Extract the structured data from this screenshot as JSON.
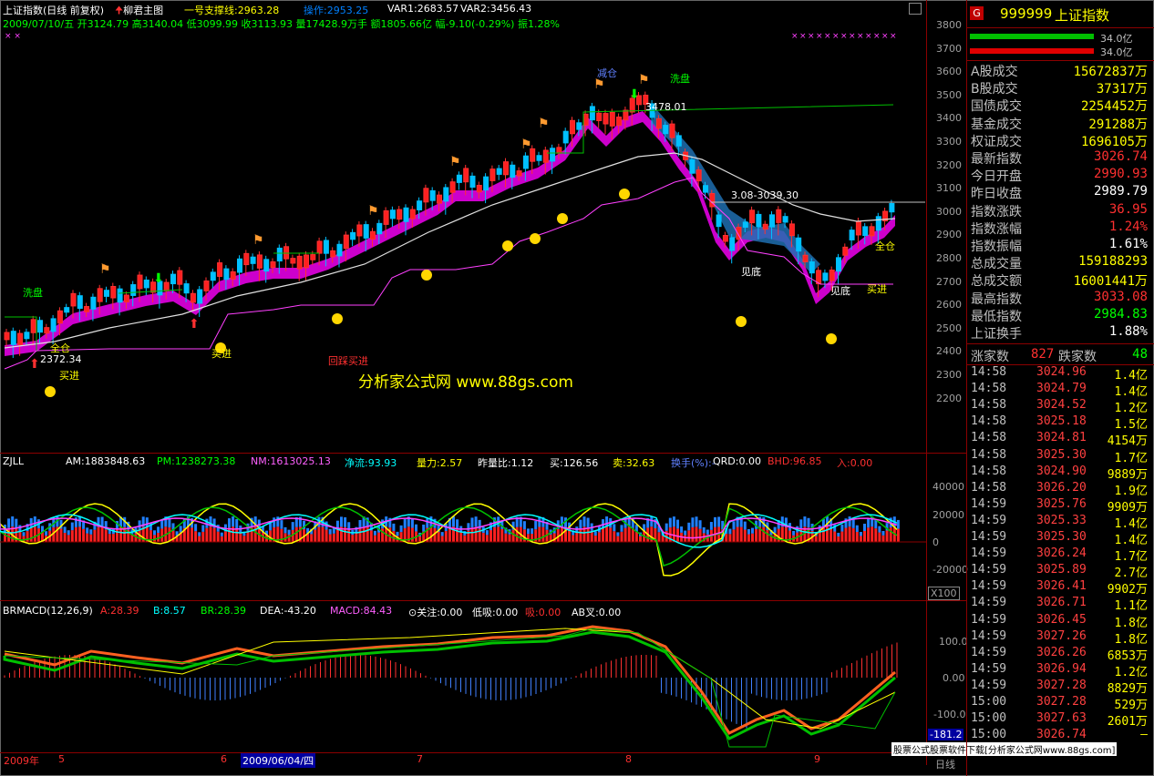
{
  "header": {
    "title": "上证指数(日线 前复权)",
    "indicator": "柳君主图",
    "support": "一号支撑线:2963.28",
    "op": "操作:2953.25",
    "var1": "VAR1:2683.57",
    "var2": "VAR2:3456.43",
    "ohlc": "2009/07/10/五 开3124.79 高3140.04 低3099.99 收3113.93 量17428.9万手 额1805.66亿 幅-9.10(-0.29%) 振1.28%"
  },
  "main_annotations": {
    "xipan1": "洗盘",
    "xipan2": "洗盘",
    "jiancang": "减仓",
    "quancang1": "全仓",
    "quancang2": "全仓",
    "maijin1": "买进",
    "maijin2": "买进",
    "maijin3": "买进",
    "huicai": "回踩买进",
    "jiandi1": "见底",
    "jiandi2": "见底",
    "low_price": "2372.34",
    "high_price": "3478.01",
    "range_text": "3.08-3039.30",
    "watermark": "分析家公式网 www.88gs.com"
  },
  "main_axis": [
    "3800",
    "3700",
    "3600",
    "3500",
    "3400",
    "3300",
    "3200",
    "3100",
    "3000",
    "2900",
    "2800",
    "2700",
    "2600",
    "2500",
    "2400",
    "2300",
    "2200"
  ],
  "zjll": {
    "name": "ZJLL",
    "am": "AM:1883848.63",
    "pm": "PM:1238273.38",
    "nm": "NM:1613025.13",
    "jl": "净流:93.93",
    "ll": "量力:2.57",
    "zlb": "昨量比:1.12",
    "buy": "买:126.56",
    "sell": "卖:32.63",
    "hs": "换手(%):-",
    "qrd": "QRD:0.00",
    "bhd": "BHD:96.85",
    "ru": "入:0.00",
    "axis": [
      "40000",
      "20000",
      "0",
      "-20000"
    ],
    "scale": "X100"
  },
  "brmacd": {
    "name": "BRMACD(12,26,9)",
    "a": "A:28.39",
    "b": "B:8.57",
    "br": "BR:28.39",
    "dea": "DEA:-43.20",
    "macd": "MACD:84.43",
    "gz": "关注:0.00",
    "dx": "低吸:0.00",
    "xi": "吸:0.00",
    "ab": "AB叉:0.00",
    "axis": [
      "100.0",
      "0.00",
      "-100.0"
    ],
    "cur": "-181.2"
  },
  "date_axis": {
    "year": "2009年",
    "m5": "5",
    "m6": "6",
    "cursor": "2009/06/04/四",
    "m7": "7",
    "m8": "8",
    "m9": "9",
    "period": "日线"
  },
  "footer": "股票公式股票软件下载[分析家公式网www.88gs.com]",
  "quote": {
    "badge": "G",
    "code": "999999",
    "name": "上证指数",
    "bar1": "34.0亿",
    "bar2": "34.0亿",
    "rows": [
      {
        "label": "A股成交",
        "value": "15672837万",
        "color": "#ffff00"
      },
      {
        "label": "B股成交",
        "value": "37317万",
        "color": "#ffff00"
      },
      {
        "label": "国债成交",
        "value": "2254452万",
        "color": "#ffff00"
      },
      {
        "label": "基金成交",
        "value": "291288万",
        "color": "#ffff00"
      },
      {
        "label": "权证成交",
        "value": "1696105万",
        "color": "#ffff00"
      },
      {
        "label": "最新指数",
        "value": "3026.74",
        "color": "#ff3030"
      },
      {
        "label": "今日开盘",
        "value": "2990.93",
        "color": "#ff3030"
      },
      {
        "label": "昨日收盘",
        "value": "2989.79",
        "color": "#ffffff"
      },
      {
        "label": "指数涨跌",
        "value": "36.95",
        "color": "#ff3030"
      },
      {
        "label": "指数涨幅",
        "value": "1.24%",
        "color": "#ff3030"
      },
      {
        "label": "指数振幅",
        "value": "1.61%",
        "color": "#ffffff"
      },
      {
        "label": "总成交量",
        "value": "159188293",
        "color": "#ffff00"
      },
      {
        "label": "总成交额",
        "value": "16001441万",
        "color": "#ffff00"
      },
      {
        "label": "最高指数",
        "value": "3033.08",
        "color": "#ff3030"
      },
      {
        "label": "最低指数",
        "value": "2984.83",
        "color": "#00ff00"
      },
      {
        "label": "上证换手",
        "value": "1.88%",
        "color": "#ffffff"
      }
    ],
    "up_label": "涨家数",
    "up": "827",
    "down_label": "跌家数",
    "down": "48",
    "ticks": [
      {
        "t": "14:58",
        "p": "3024.96",
        "v": "1.4亿"
      },
      {
        "t": "14:58",
        "p": "3024.79",
        "v": "1.4亿"
      },
      {
        "t": "14:58",
        "p": "3024.52",
        "v": "1.2亿"
      },
      {
        "t": "14:58",
        "p": "3025.18",
        "v": "1.5亿"
      },
      {
        "t": "14:58",
        "p": "3024.81",
        "v": "4154万"
      },
      {
        "t": "14:58",
        "p": "3025.30",
        "v": "1.7亿"
      },
      {
        "t": "14:58",
        "p": "3024.90",
        "v": "9889万"
      },
      {
        "t": "14:58",
        "p": "3026.20",
        "v": "1.9亿"
      },
      {
        "t": "14:59",
        "p": "3025.76",
        "v": "9909万"
      },
      {
        "t": "14:59",
        "p": "3025.33",
        "v": "1.4亿"
      },
      {
        "t": "14:59",
        "p": "3025.30",
        "v": "1.4亿"
      },
      {
        "t": "14:59",
        "p": "3026.24",
        "v": "1.7亿"
      },
      {
        "t": "14:59",
        "p": "3025.89",
        "v": "2.7亿"
      },
      {
        "t": "14:59",
        "p": "3026.41",
        "v": "9902万"
      },
      {
        "t": "14:59",
        "p": "3026.71",
        "v": "1.1亿"
      },
      {
        "t": "14:59",
        "p": "3026.45",
        "v": "1.8亿"
      },
      {
        "t": "14:59",
        "p": "3027.26",
        "v": "1.8亿"
      },
      {
        "t": "14:59",
        "p": "3026.26",
        "v": "6853万"
      },
      {
        "t": "14:59",
        "p": "3026.94",
        "v": "1.2亿"
      },
      {
        "t": "14:59",
        "p": "3027.28",
        "v": "8829万"
      },
      {
        "t": "15:00",
        "p": "3027.28",
        "v": "529万"
      },
      {
        "t": "15:00",
        "p": "3027.63",
        "v": "2601万"
      },
      {
        "t": "15:00",
        "p": "3026.74",
        "v": "—"
      }
    ]
  }
}
